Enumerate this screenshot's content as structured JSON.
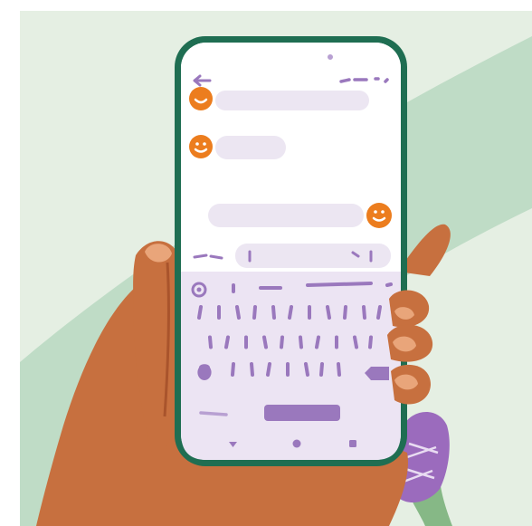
{
  "scene": {
    "background": "#ffffff",
    "backdrop_light": "#e5efe3",
    "backdrop_stroke": "#bfdcc6",
    "skin": "#c7703f",
    "skin_shadow": "#a9542c",
    "nail": "#e9a57a",
    "phone_frame": "#1f6e52",
    "screen_bg": "#ffffff",
    "bubble": "#ece6f2",
    "keyboard_bg": "#ece4f3",
    "key_mark": "#9a78bd",
    "key_mark_light": "#b8a0d2",
    "avatar": "#ec7d1e",
    "shoe": "#9b6bbd",
    "shoe_lace": "#e9dcf2",
    "pants": "#86b886"
  },
  "icons": {
    "back": "arrow-left-icon",
    "menu": "more-options-icon",
    "avatar": "smiley-avatar-icon",
    "emoji": "emoji-icon",
    "backspace": "backspace-icon"
  },
  "chat": {
    "incoming_messages": 2,
    "outgoing_messages": 1
  }
}
